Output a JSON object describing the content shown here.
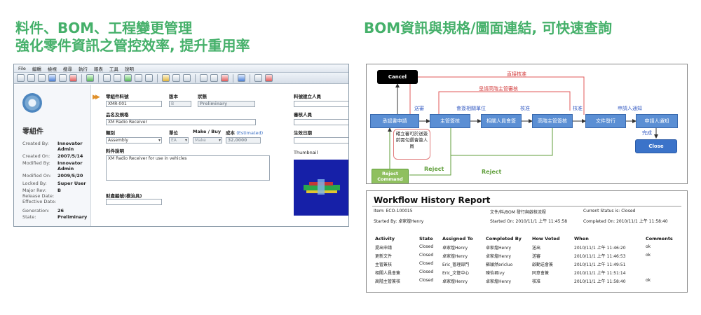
{
  "headings": {
    "left_line1": "料件、BOM、工程變更管理",
    "left_line2": "強化零件資訊之管控效率, 提升重用率",
    "right": "BOM資訊與規格/圖面連結, 可快速查詢"
  },
  "plm": {
    "menu": [
      "File",
      "編輯",
      "檢視",
      "搜尋",
      "執行",
      "報表",
      "工具",
      "說明"
    ],
    "side": {
      "title": "零組件",
      "rows": [
        {
          "label": "Created By:",
          "value": "Innovator Admin"
        },
        {
          "label": "Created On:",
          "value": "2007/5/14"
        },
        {
          "label": "Modified By:",
          "value": "Innovator Admin"
        },
        {
          "label": "Modified On:",
          "value": "2009/5/20"
        },
        {
          "label": "Locked By:",
          "value": "Super User"
        },
        {
          "label": "Major Rev:",
          "value": "B"
        },
        {
          "label": "Release Date:",
          "value": ""
        },
        {
          "label": "Effective Date:",
          "value": ""
        },
        {
          "label": "Generation:",
          "value": "26"
        },
        {
          "label": "State:",
          "value": "Preliminary"
        }
      ]
    },
    "form": {
      "part_no_label": "零組件料號",
      "part_no_value": "XMR-001",
      "rev_label": "版本",
      "rev_value": "B",
      "status_label": "狀態",
      "status_value": "Preliminary",
      "creator_label": "料號建立人員",
      "name_label": "品名及規格",
      "name_value": "XM Radio Receiver",
      "reviewer_label": "審核人員",
      "category_label": "類別",
      "category_value": "Assembly",
      "unit_label": "單位",
      "unit_value": "EA",
      "makebuy_label": "Make / Buy",
      "makebuy_value": "Make",
      "cost_label": "成本",
      "cost_note": "(Estimated)",
      "cost_value": "32.0000",
      "date_label": "生效日期",
      "desc_label": "料件說明",
      "desc_value": "XM Radio Receiver for use in vehicles",
      "thumb_label": "Thumbnail",
      "asset_label": "財產編號(模治具)"
    }
  },
  "workflow": {
    "cancel": "Cancel",
    "direct_approve": "直接核准",
    "upper_approve": "呈請高階主管審核",
    "send_review": "送審",
    "countersign_dept": "會簽相關單位",
    "approve1": "核准",
    "approve2": "核准",
    "notify_requester": "申請人通知",
    "nodes": [
      {
        "label": "承認書申請"
      },
      {
        "label": "主管簽核"
      },
      {
        "label": "相關人員會簽"
      },
      {
        "label": "高階主管簽核"
      },
      {
        "label": "文件發行"
      },
      {
        "label": "申請人通知"
      }
    ],
    "done": "完成",
    "close": "Close",
    "note": "確立審可於送簽前需勾選會簽人員",
    "reject1": "Reject",
    "reject2": "Reject",
    "reject_command": "Reject Command"
  },
  "report": {
    "title": "Workflow History Report",
    "item": "Item: ECO-100015",
    "started_by": "Started By: 卓家煌Henry",
    "flow_name": "文件/料/BOM 發行與啟核流程",
    "started_on": "Started On: 2010/11/1 上午 11:45:58",
    "current_status": "Current Status is: Closed",
    "completed_on": "Completed On: 2010/11/1 上午 11:58:40",
    "columns": [
      "Activity",
      "State",
      "Assigned To",
      "Completed By",
      "How Voted",
      "When",
      "Comments"
    ],
    "rows": [
      [
        "提出申請",
        "Closed",
        "卓家煌Henry",
        "卓家煌Henry",
        "送出",
        "2010/11/1 上午 11:46:20",
        "ok"
      ],
      [
        "更新文件",
        "Closed",
        "卓家煌Henry",
        "卓家煌Henry",
        "送審",
        "2010/11/1 上午 11:46:53",
        "ok"
      ],
      [
        "主管簽核",
        "Closed",
        "Eric_管理部門",
        "蘇穎然ericluo",
        "啟動送會簽",
        "2010/11/1 上午 11:49:51",
        ""
      ],
      [
        "相關人員會簽",
        "Closed",
        "Eric_文管中心",
        "陳怡君ivy",
        "同意會簽",
        "2010/11/1 上午 11:51:14",
        ""
      ],
      [
        "高階主管簽核",
        "Closed",
        "卓家煌Henry",
        "卓家煌Henry",
        "核准",
        "2010/11/1 上午 11:58:40",
        "ok"
      ]
    ]
  }
}
